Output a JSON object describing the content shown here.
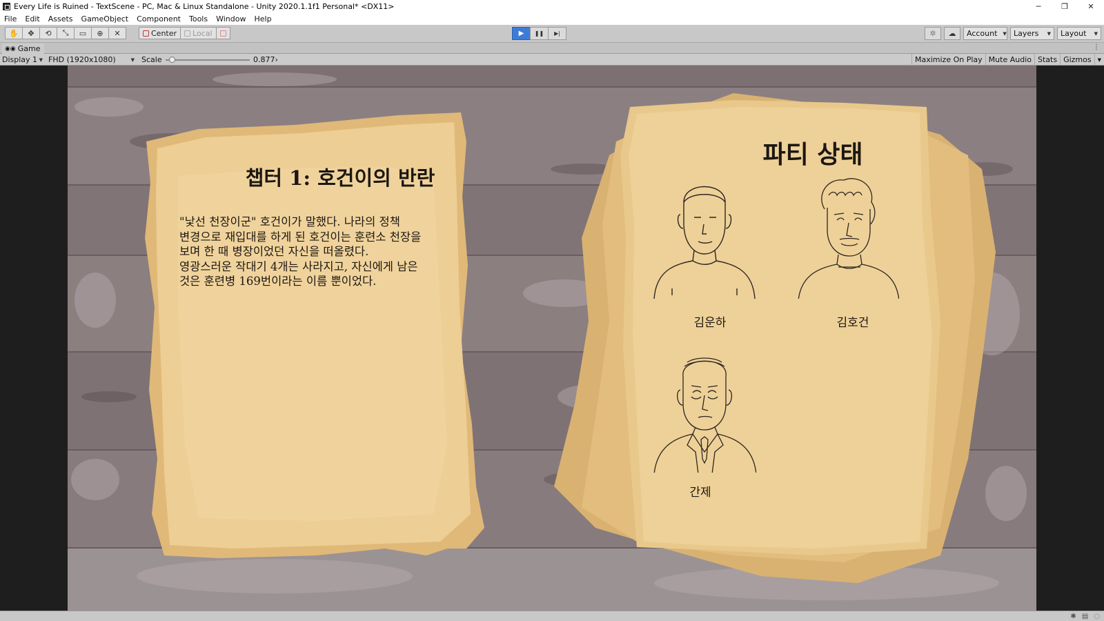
{
  "window": {
    "title": "Every Life is Ruined - TextScene - PC, Mac & Linux Standalone - Unity 2020.1.1f1 Personal* <DX11>",
    "controls": {
      "minimize": "─",
      "restore": "❐",
      "close": "✕"
    }
  },
  "menu": [
    "File",
    "Edit",
    "Assets",
    "GameObject",
    "Component",
    "Tools",
    "Window",
    "Help"
  ],
  "toolbar": {
    "tools": [
      "hand-tool",
      "move-tool",
      "rotate-tool",
      "scale-tool",
      "rect-tool",
      "transform-tool",
      "custom-tool"
    ],
    "tool_glyphs": [
      "✋",
      "✥",
      "⟲",
      "⤡",
      "▭",
      "⊕",
      "✕"
    ],
    "pivot_label": "Center",
    "rotation_label": "Local",
    "play_glyph": "▶",
    "pause_glyph": "❚❚",
    "step_glyph": "▶|",
    "account_label": "Account",
    "layers_label": "Layers",
    "layout_label": "Layout",
    "collab_glyph": "✲",
    "cloud_glyph": "☁",
    "accent_color": "#3d7bd8"
  },
  "game_tab": {
    "label": "Game",
    "icon": "gamepad-icon",
    "menu_glyph": "⋮"
  },
  "game_toolbar": {
    "display": "Display 1",
    "resolution": "FHD (1920x1080)",
    "scale_label": "Scale",
    "scale_value": "0.877",
    "scale_fraction": 0.04,
    "maximize_on_play": "Maximize On Play",
    "mute_audio": "Mute Audio",
    "stats": "Stats",
    "gizmos": "Gizmos"
  },
  "scene": {
    "chapter_title": "챕터 1: 호건이의 반란",
    "story_text": "\"낯선 천장이군\" 호건이가 말했다. 나라의 정책\n변경으로 재입대를 하게 된 호건이는 훈련소 천장을\n보며 한 때 병장이었던 자신을 떠올렸다.\n영광스러운 작대기 4개는 사라지고, 자신에게 남은\n것은 훈련병 169번이라는 이름 뿐이었다.",
    "party_title": "파티 상태",
    "party": [
      {
        "name": "김운하",
        "portrait": "young-man-portrait"
      },
      {
        "name": "김호건",
        "portrait": "curly-hair-man-portrait"
      },
      {
        "name": "간제",
        "portrait": "old-man-suit-portrait"
      }
    ]
  }
}
